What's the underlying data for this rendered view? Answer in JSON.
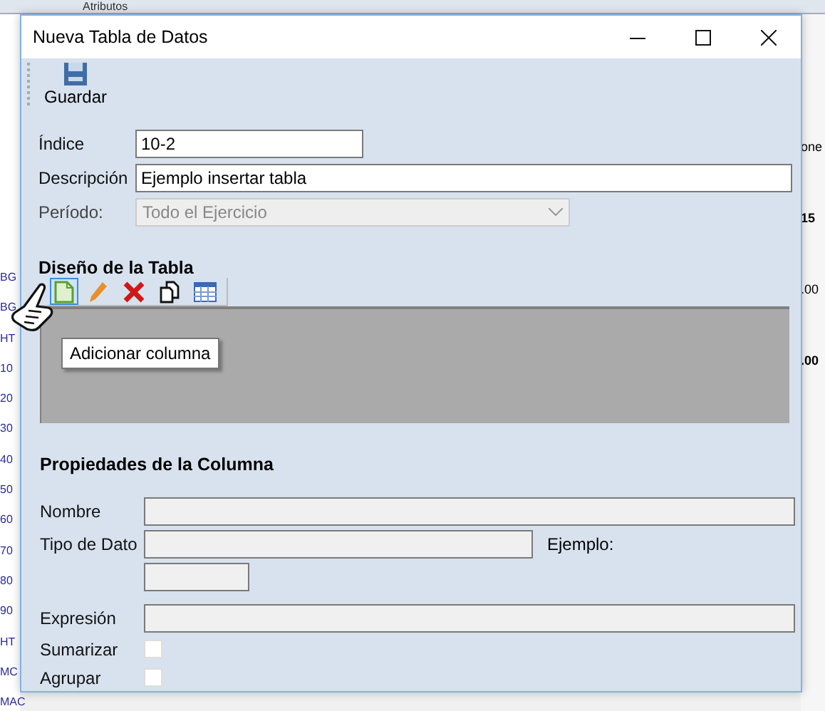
{
  "background": {
    "header": "Atributos",
    "left_column": [
      "BG",
      "BG",
      "HT",
      "10",
      "20",
      "30",
      "40",
      "50",
      "60",
      "70",
      "80",
      "90",
      "HT",
      "MC",
      "MAC"
    ],
    "right_column": [
      "one",
      "15",
      ".00",
      ".00"
    ]
  },
  "window": {
    "title": "Nueva Tabla de Datos"
  },
  "toolbar": {
    "buttons": [
      {
        "label": "Guardar"
      }
    ]
  },
  "form": {
    "fields": [
      {
        "kind": "text",
        "label": "Índice",
        "value": "10-2",
        "disabled": false
      },
      {
        "kind": "text",
        "label": "Descripción",
        "value": "Ejemplo insertar tabla",
        "disabled": false
      },
      {
        "kind": "select",
        "label": "Período:",
        "value": "Todo el Ejercicio",
        "disabled": true
      }
    ]
  },
  "table_design": {
    "title": "Diseño de la Tabla",
    "tools": [
      {
        "kind": "add",
        "selected": true
      },
      {
        "kind": "edit",
        "selected": false
      },
      {
        "kind": "delete",
        "selected": false
      },
      {
        "kind": "copy",
        "selected": false
      },
      {
        "kind": "table",
        "selected": false
      }
    ],
    "tooltip": "Adicionar columna"
  },
  "column_properties": {
    "title": "Propiedades de la Columna",
    "name_label": "Nombre",
    "type_label": "Tipo de Dato",
    "example_label": "Ejemplo:",
    "expression_label": "Expresión",
    "checkboxes": [
      {
        "label": "Sumarizar",
        "checked": false
      },
      {
        "label": "Agrupar",
        "checked": false
      }
    ]
  }
}
